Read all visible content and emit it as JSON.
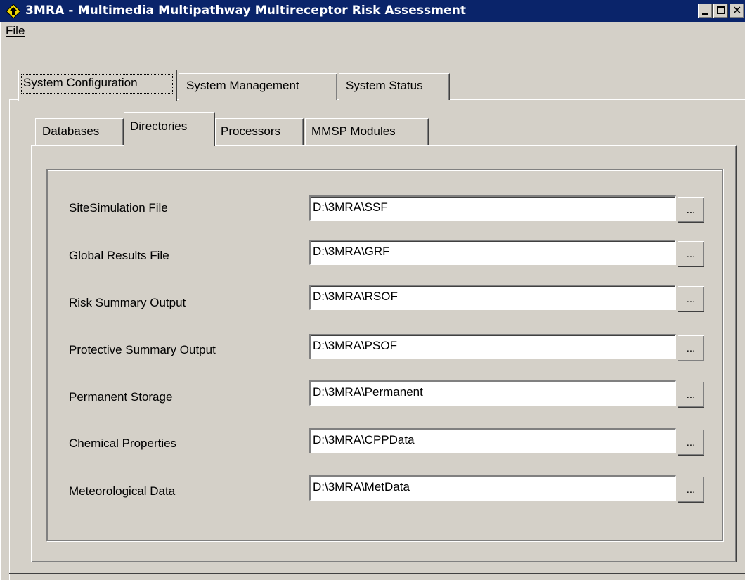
{
  "window": {
    "title": "3MRA - Multimedia Multipathway Multireceptor Risk Assessment",
    "icon": "diamond-arrow-icon",
    "titlebar_color": "#0a246a",
    "controls": {
      "minimize_icon": "minimize-icon",
      "maximize_icon": "maximize-icon",
      "close_glyph": "✕"
    }
  },
  "menu": {
    "file": "File"
  },
  "outer_tabs": [
    {
      "label": "System Configuration",
      "active": true
    },
    {
      "label": "System Management",
      "active": false
    },
    {
      "label": "System Status",
      "active": false
    }
  ],
  "inner_tabs": [
    {
      "label": "Databases",
      "active": false
    },
    {
      "label": "Directories",
      "active": true
    },
    {
      "label": "Processors",
      "active": false
    },
    {
      "label": "MMSP Modules",
      "active": false
    }
  ],
  "directories": [
    {
      "label": "SiteSimulation File",
      "value": "D:\\3MRA\\SSF",
      "browse": "..."
    },
    {
      "label": "Global Results File",
      "value": "D:\\3MRA\\GRF",
      "browse": "..."
    },
    {
      "label": "Risk Summary Output",
      "value": "D:\\3MRA\\RSOF",
      "browse": "..."
    },
    {
      "label": "Protective Summary Output",
      "value": "D:\\3MRA\\PSOF",
      "browse": "..."
    },
    {
      "label": "Permanent Storage",
      "value": "D:\\3MRA\\Permanent",
      "browse": "..."
    },
    {
      "label": "Chemical Properties",
      "value": "D:\\3MRA\\CPPData",
      "browse": "..."
    },
    {
      "label": "Meteorological Data",
      "value": "D:\\3MRA\\MetData",
      "browse": "..."
    }
  ]
}
